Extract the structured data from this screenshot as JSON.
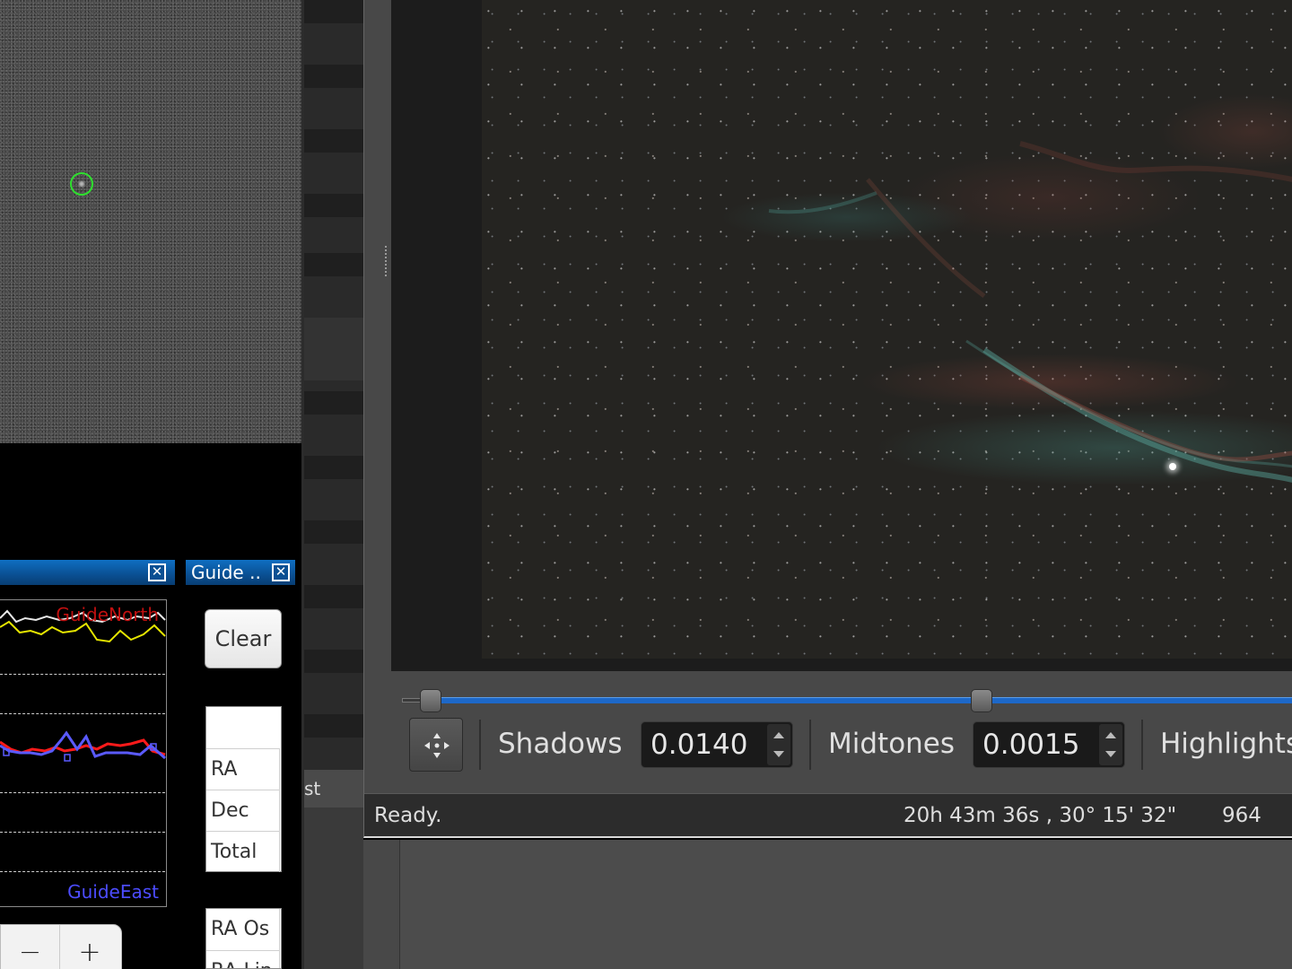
{
  "guide_view": {
    "marker_color": "#2ee02e"
  },
  "drift_panel": {
    "legend_north": "GuideNorth",
    "legend_east": "GuideEast",
    "north_color": "#c01010",
    "east_color": "#4c4cff",
    "zoom_out_label": "−",
    "zoom_in_label": "+"
  },
  "stats_panel": {
    "title": "Guide ..",
    "clear_label": "Clear",
    "rows": [
      "RA",
      "Dec",
      "Total"
    ],
    "rows2": [
      "RA Os",
      "RA Lin"
    ]
  },
  "mid_strip": {
    "tab_label": "st"
  },
  "viewer": {
    "toolbar": {
      "shadows_label": "Shadows",
      "shadows_value": "0.0140",
      "midtones_label": "Midtones",
      "midtones_value": "0.0015",
      "highlights_label": "Highlights"
    },
    "slider_track_color": "#1d68c8",
    "status": {
      "message": "Ready.",
      "coordinates": "20h 43m 36s ,  30° 15' 32\"",
      "value": "964"
    }
  }
}
